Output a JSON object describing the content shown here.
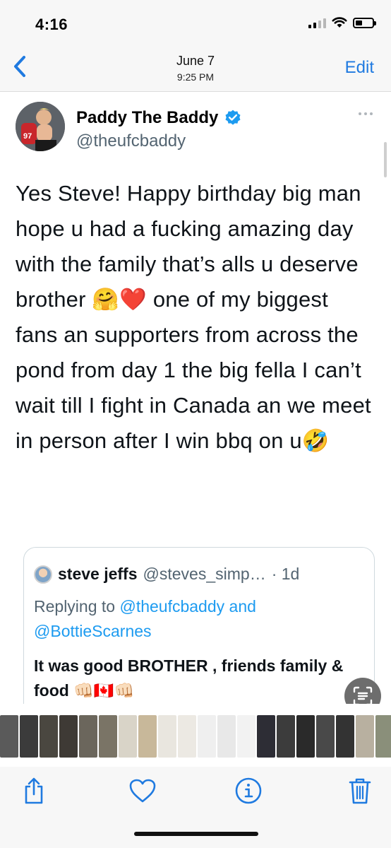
{
  "status_bar": {
    "time": "4:16"
  },
  "nav": {
    "date": "June 7",
    "time": "9:25 PM",
    "edit_label": "Edit"
  },
  "tweet": {
    "author_name": "Paddy The Baddy",
    "author_handle": "@theufcbaddy",
    "text": "Yes Steve! Happy birthday big man hope u had a fucking amazing day with the family that’s alls u deserve brother 🤗❤️ one of my biggest fans an supporters from across the pond from day 1 the big fella I can’t wait till I fight in Canada an we meet in person after I win bbq on u🤣"
  },
  "quote": {
    "name": "steve jeffs",
    "handle": "@steves_simp…",
    "age": "· 1d",
    "replying_prefix": "Replying to",
    "reply_to_1": "@theufcbaddy",
    "reply_and": "and",
    "reply_to_2": "@BottieScarnes",
    "text": "It was good BROTHER , friends family & food 👊🏻🇨🇦👊🏻"
  },
  "thumbnails": [
    "#5a5a5a",
    "#3b3b3b",
    "#4a4740",
    "#3e3a35",
    "#6b665c",
    "#7a7466",
    "#d9d4c8",
    "#c8b89a",
    "#e9e6df",
    "#ece9e3",
    "#efefef",
    "#e8e8e8",
    "#f2f2f2",
    "#2d2d35",
    "#3c3c3c",
    "#2a2a2a",
    "#494949",
    "#333333",
    "#b8b0a0",
    "#8a8f7a",
    "#6a6a6a",
    "#4f4f4f"
  ],
  "icons": {
    "back": "chevron-left-icon",
    "share": "share-icon",
    "favorite": "heart-icon",
    "info": "info-icon",
    "delete": "trash-icon",
    "live_text": "live-text-icon",
    "more": "more-icon",
    "verified": "verified-badge-icon"
  },
  "colors": {
    "ios_blue": "#1f7ae0",
    "twitter_blue": "#1d9bf0",
    "handle_gray": "#536471"
  }
}
